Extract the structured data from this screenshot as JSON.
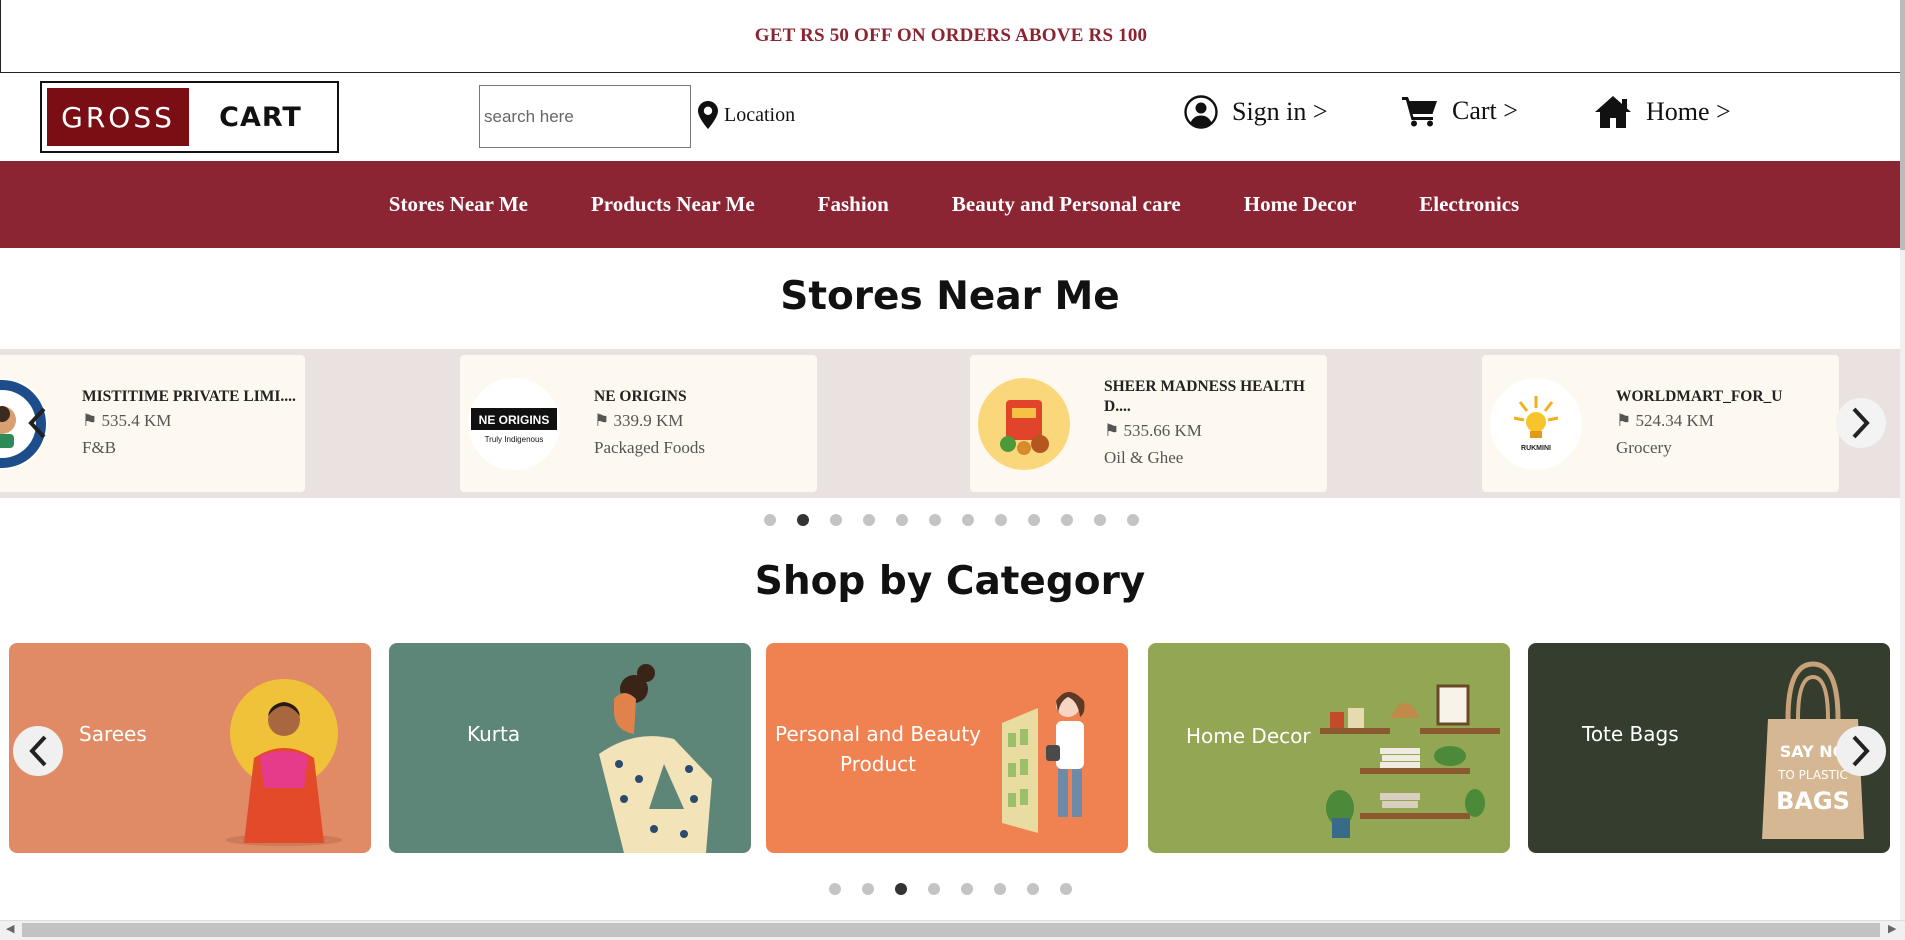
{
  "promo": {
    "text": "GET RS 50 OFF ON ORDERS ABOVE RS 100"
  },
  "header": {
    "logo_left": "GROSS",
    "logo_right": "CART",
    "search_placeholder": "search here",
    "location_label": "Location",
    "signin_label": "Sign in >",
    "cart_label": "Cart >",
    "home_label": "Home >"
  },
  "nav": {
    "items": [
      "Stores Near Me",
      "Products Near Me",
      "Fashion",
      "Beauty and Personal care",
      "Home Decor",
      "Electronics"
    ]
  },
  "stores_section": {
    "title": "Stores Near Me",
    "stores": [
      {
        "name": "MISTITIME PRIVATE LIMI....",
        "distance": "535.4 KM",
        "category": "F&B"
      },
      {
        "name": "NE ORIGINS",
        "distance": "339.9 KM",
        "category": "Packaged Foods",
        "logo_text": "NE ORIGINS",
        "logo_sub": "Truly Indigenous"
      },
      {
        "name_line1": "SHEER MADNESS HEALTH",
        "name_line2": "D....",
        "distance": "535.66 KM",
        "category": "Oil & Ghee"
      },
      {
        "name": "WORLDMART_FOR_U",
        "distance": "524.34 KM",
        "category": "Grocery",
        "logo_text": "RUKMINI"
      }
    ],
    "dots_count": 12,
    "active_dot": 2
  },
  "category_section": {
    "title": "Shop by Category",
    "categories": [
      {
        "label": "Sarees"
      },
      {
        "label": "Kurta"
      },
      {
        "label_line1": "Personal and Beauty",
        "label_line2": "Product"
      },
      {
        "label": "Home Decor"
      },
      {
        "label": "Tote Bags",
        "bag_text_1": "SAY NO",
        "bag_text_2": "TO PLASTIC",
        "bag_text_3": "BAGS"
      }
    ],
    "dots_count": 8,
    "active_dot": 3
  },
  "colors": {
    "brand": "#8c2533",
    "promo_text": "#8c2330",
    "logo_bg": "#7a0e14",
    "strip_bg": "#e9e2e1",
    "card_bg": "#fdf9f0"
  },
  "icons": {
    "location": "map-pin-icon",
    "signin": "user-circle-icon",
    "cart": "shopping-cart-icon",
    "home": "home-icon",
    "carousel_prev": "chevron-left-icon",
    "carousel_next": "chevron-right-icon"
  }
}
